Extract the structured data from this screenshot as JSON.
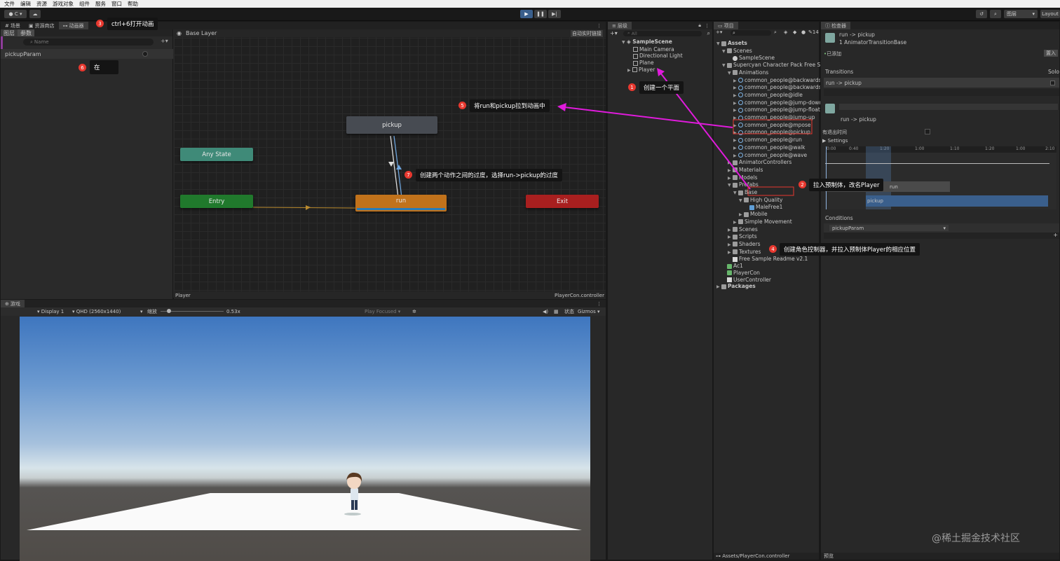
{
  "menubar": {
    "items": [
      "文件",
      "编辑",
      "资源",
      "游戏对象",
      "组件",
      "服务",
      "窗口",
      "帮助"
    ]
  },
  "toolbar": {
    "account": "C",
    "layers_label": "图层",
    "layout_label": "Layout"
  },
  "left_tabs": [
    "场景",
    "资源商店",
    "动画器"
  ],
  "animator": {
    "sub_tabs": [
      "图层",
      "参数"
    ],
    "search_placeholder": "Name",
    "param_name": "pickupParam",
    "layer_name": "Base Layer",
    "auto_live_link": "自动实时链接",
    "footer_left": "Player",
    "footer_right": "PlayerCon.controller",
    "nodes": {
      "pickup": "pickup",
      "any_state": "Any State",
      "entry": "Entry",
      "run": "run",
      "exit": "Exit"
    }
  },
  "game": {
    "tab": "游戏",
    "display": "Display 1",
    "resolution": "QHD (2560x1440)",
    "scale_label": "缩放",
    "scale_value": "0.53x",
    "play_focused": "Play Focused",
    "stats": "状态",
    "gizmos": "Gizmos"
  },
  "hierarchy": {
    "tab": "层级",
    "search_placeholder": "All",
    "scene": "SampleScene",
    "items": [
      "Main Camera",
      "Directional Light",
      "Plane",
      "Player"
    ]
  },
  "project": {
    "tab": "项目",
    "count": "14",
    "footer_path": "Assets/PlayerCon.controller",
    "tree": [
      {
        "label": "Assets",
        "depth": 0,
        "icon": "folder",
        "arrow": "▼"
      },
      {
        "label": "Scenes",
        "depth": 1,
        "icon": "folder",
        "arrow": "▼"
      },
      {
        "label": "SampleScene",
        "depth": 2,
        "icon": "scene",
        "arrow": ""
      },
      {
        "label": "Supercyan Character Pack Free Sar",
        "depth": 1,
        "icon": "folder",
        "arrow": "▼"
      },
      {
        "label": "Animations",
        "depth": 2,
        "icon": "folder",
        "arrow": "▼"
      },
      {
        "label": "common_people@backwards",
        "depth": 3,
        "icon": "anim",
        "arrow": "▶"
      },
      {
        "label": "common_people@backwards",
        "depth": 3,
        "icon": "anim",
        "arrow": "▶"
      },
      {
        "label": "common_people@idle",
        "depth": 3,
        "icon": "anim",
        "arrow": "▶"
      },
      {
        "label": "common_people@jump-down",
        "depth": 3,
        "icon": "anim",
        "arrow": "▶"
      },
      {
        "label": "common_people@jump-float",
        "depth": 3,
        "icon": "anim",
        "arrow": "▶"
      },
      {
        "label": "common_people@jump-up",
        "depth": 3,
        "icon": "anim",
        "arrow": "▶"
      },
      {
        "label": "common_people@mpose",
        "depth": 3,
        "icon": "anim",
        "arrow": "▶"
      },
      {
        "label": "common_people@pickup",
        "depth": 3,
        "icon": "anim",
        "arrow": "▶"
      },
      {
        "label": "common_people@run",
        "depth": 3,
        "icon": "anim",
        "arrow": "▶"
      },
      {
        "label": "common_people@walk",
        "depth": 3,
        "icon": "anim",
        "arrow": "▶"
      },
      {
        "label": "common_people@wave",
        "depth": 3,
        "icon": "anim",
        "arrow": "▶"
      },
      {
        "label": "AnimatorControllers",
        "depth": 2,
        "icon": "folder",
        "arrow": "▶"
      },
      {
        "label": "Materials",
        "depth": 2,
        "icon": "folder",
        "arrow": "▶"
      },
      {
        "label": "Models",
        "depth": 2,
        "icon": "folder",
        "arrow": "▶"
      },
      {
        "label": "Prefabs",
        "depth": 2,
        "icon": "folder",
        "arrow": "▼"
      },
      {
        "label": "Base",
        "depth": 3,
        "icon": "folder",
        "arrow": "▼"
      },
      {
        "label": "High Quality",
        "depth": 4,
        "icon": "folder",
        "arrow": "▼"
      },
      {
        "label": "MaleFree1",
        "depth": 5,
        "icon": "prefab",
        "arrow": ""
      },
      {
        "label": "Mobile",
        "depth": 4,
        "icon": "folder",
        "arrow": "▶"
      },
      {
        "label": "Simple Movement",
        "depth": 3,
        "icon": "folder",
        "arrow": "▶"
      },
      {
        "label": "Scenes",
        "depth": 2,
        "icon": "folder",
        "arrow": "▶"
      },
      {
        "label": "Scripts",
        "depth": 2,
        "icon": "folder",
        "arrow": "▶"
      },
      {
        "label": "Shaders",
        "depth": 2,
        "icon": "folder",
        "arrow": "▶"
      },
      {
        "label": "Textures",
        "depth": 2,
        "icon": "folder",
        "arrow": "▶"
      },
      {
        "label": "Free Sample Readme v2.1",
        "depth": 2,
        "icon": "doc",
        "arrow": ""
      },
      {
        "label": "Ac1",
        "depth": 1,
        "icon": "ctrl",
        "arrow": ""
      },
      {
        "label": "PlayerCon",
        "depth": 1,
        "icon": "ctrl",
        "arrow": ""
      },
      {
        "label": "UserController",
        "depth": 1,
        "icon": "doc",
        "arrow": ""
      },
      {
        "label": "Packages",
        "depth": 0,
        "icon": "folder",
        "arrow": "▶"
      }
    ]
  },
  "inspector": {
    "tab": "检查器",
    "title": "run -> pickup",
    "subtitle": "1 AnimatorTransitionBase",
    "added_label": "已添加",
    "import_btn": "置入",
    "transitions_label": "Transitions",
    "solo_label": "Solo",
    "transition_row": "run -> pickup",
    "sub_title": "run -> pickup",
    "has_exit_time": "有退出时间",
    "settings": "Settings",
    "timeline_ticks": [
      "0:00",
      "0:40",
      "1:20",
      "1:00",
      "1:10",
      "1:20",
      "1:00",
      "2:10"
    ],
    "clip_run": "run",
    "clip_pickup": "pickup",
    "conditions_label": "Conditions",
    "condition_param": "pickupParam",
    "preview_label": "预览"
  },
  "callouts": [
    {
      "num": "1",
      "text": "创建一个平面"
    },
    {
      "num": "2",
      "text": "拉入预制体，改名Player"
    },
    {
      "num": "3",
      "text": "ctrl+6打开动画"
    },
    {
      "num": "4",
      "text": "创建角色控制器，并拉入预制体Player的相应位置"
    },
    {
      "num": "5",
      "text": "将run和pickup拉到动画中"
    },
    {
      "num": "6",
      "text": "在"
    },
    {
      "num": "7",
      "text": "创建两个动作之间的过度，选择run->pickup的过度"
    }
  ],
  "watermark": "@稀土掘金技术社区",
  "colors": {
    "accent": "#e01bdc",
    "entry": "#20792c",
    "run": "#c1721b",
    "exit": "#a81f1f",
    "any_state": "#3f8a78",
    "pickup": "#474b52"
  }
}
